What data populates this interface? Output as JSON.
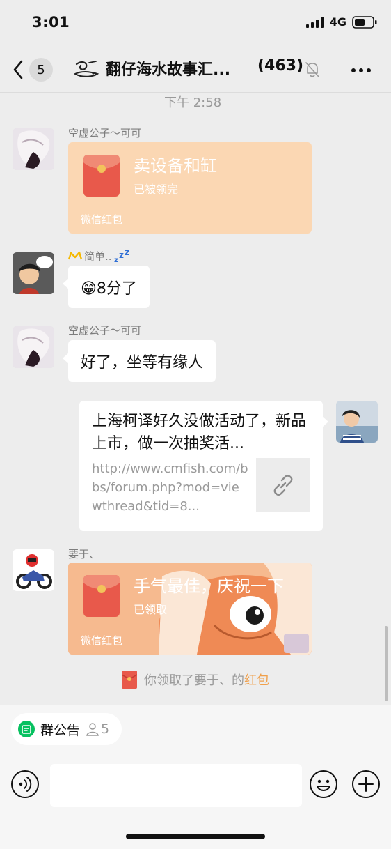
{
  "status_bar": {
    "time": "3:01",
    "network": "4G"
  },
  "header": {
    "unread_count": "5",
    "title": "翻仔海水故事汇...",
    "member_count": "(463)"
  },
  "chat": {
    "timestamp": "下午 2:58",
    "messages": [
      {
        "sender": "空虚公子～可可",
        "type": "red_packet",
        "title": "卖设备和缸",
        "status": "已被领完",
        "footer": "微信红包"
      },
      {
        "sender": "简单..",
        "type": "text",
        "text": "😁8分了"
      },
      {
        "sender": "空虚公子～可可",
        "type": "text",
        "text": "好了，坐等有缘人"
      },
      {
        "type": "link",
        "title": "上海柯译好久没做活动了，新品上市，做一次抽奖活...",
        "url": "http://www.cmfish.com/bbs/forum.php?mod=viewthread&tid=8..."
      },
      {
        "sender": "要于、",
        "type": "red_packet",
        "title": "手气最佳，庆祝一下",
        "status": "已领取",
        "footer": "微信红包"
      }
    ],
    "system_message": {
      "prefix": "你领取了要于、的",
      "link": "红包"
    }
  },
  "bottom": {
    "announcement_label": "群公告",
    "announcement_count": "5"
  },
  "colors": {
    "background": "#ededed",
    "red_packet": "#fbd7b3",
    "accent_orange": "#f0a04b",
    "green": "#07c160"
  }
}
